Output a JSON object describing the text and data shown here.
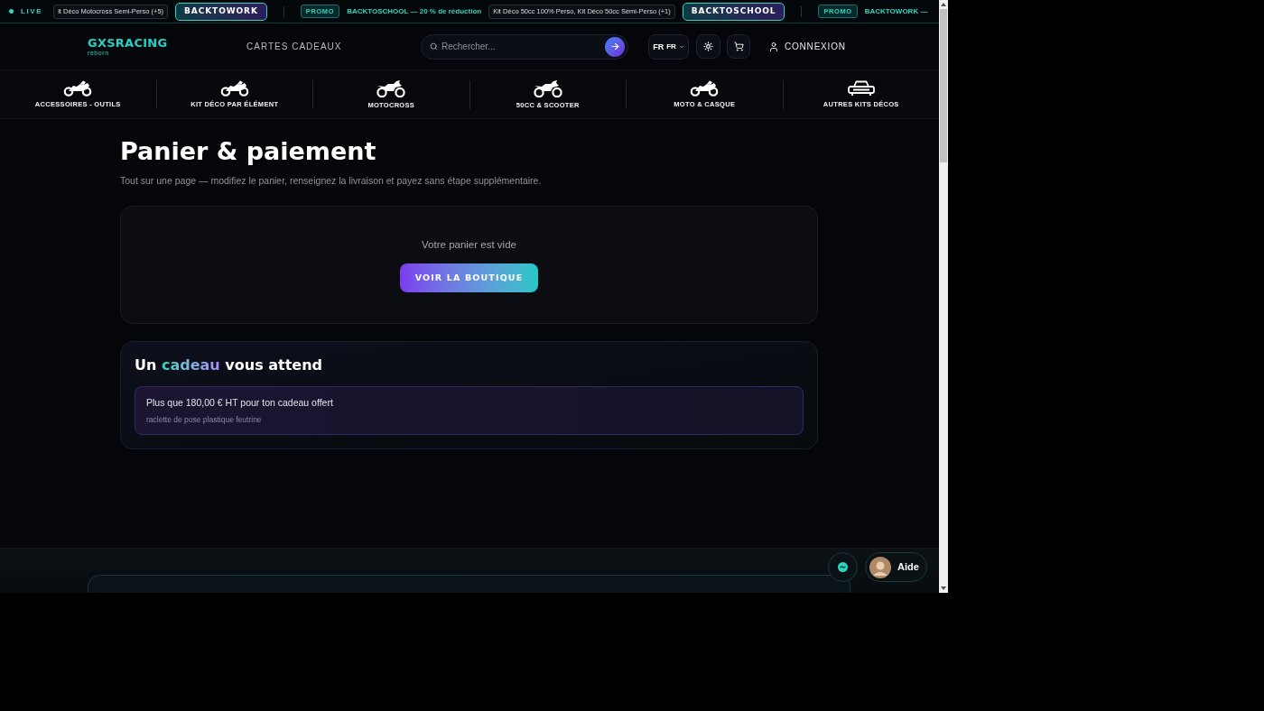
{
  "ticker": {
    "live_label": "LIVE",
    "groups": [
      {
        "products": "it Déco Motocross Semi-Perso (+5)",
        "code": "BACKTOWORK"
      },
      {
        "tag": "PROMO",
        "offer": "BACKTOSCHOOL — 20 % de réduction",
        "products": "Kit Déco 50cc 100% Perso, Kit Déco 50cc Semi-Perso (+1)",
        "code": "BACKTOSCHOOL"
      },
      {
        "tag": "PROMO",
        "offer": "BACKTOWORK —"
      }
    ]
  },
  "header": {
    "logo": {
      "name": "GXSRACING",
      "tagline": "reborn"
    },
    "gift_cards_link": "CARTES CADEAUX",
    "search": {
      "placeholder": "Rechercher..."
    },
    "language": {
      "flag": "FR",
      "code": "FR"
    },
    "login": "CONNEXION"
  },
  "categories": [
    "ACCESSOIRES - OUTILS",
    "KIT DÉCO PAR ÉLÉMENT",
    "MOTOCROSS",
    "50CC & SCOOTER",
    "MOTO & CASQUE",
    "AUTRES KITS DÉCOS"
  ],
  "page": {
    "title": "Panier & paiement",
    "subtitle": "Tout sur une page — modifiez le panier, renseignez la livraison et payez sans étape supplémentaire."
  },
  "cart": {
    "empty_message": "Votre panier est vide",
    "shop_button": "VOIR LA BOUTIQUE"
  },
  "gift": {
    "title_parts": [
      {
        "text": "Un",
        "highlight": false
      },
      {
        "text": "cadeau",
        "highlight": true
      },
      {
        "text": "vous attend",
        "highlight": false
      }
    ],
    "progress_message": "Plus que 180,00 € HT pour ton cadeau offert",
    "gift_name": "raclette de pose plastique feutrine"
  },
  "help": {
    "label": "Aide"
  }
}
